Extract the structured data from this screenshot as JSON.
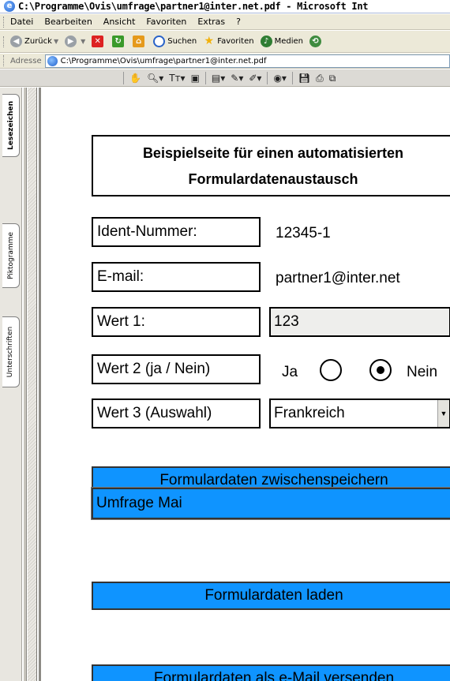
{
  "window": {
    "title": "C:\\Programme\\Ovis\\umfrage\\partner1@inter.net.pdf - Microsoft Int"
  },
  "menu": [
    "Datei",
    "Bearbeiten",
    "Ansicht",
    "Favoriten",
    "Extras",
    "?"
  ],
  "toolbar": {
    "back": "Zurück",
    "search": "Suchen",
    "favorites": "Favoriten",
    "media": "Medien"
  },
  "address": {
    "label": "Adresse",
    "url": "C:\\Programme\\Ovis\\umfrage\\partner1@inter.net.pdf"
  },
  "side_tabs": [
    "Lesezeichen",
    "Piktogramme",
    "Unterschriften"
  ],
  "form": {
    "title_line1": "Beispielseite für einen automatisierten",
    "title_line2": "Formulardatenaustausch",
    "ident_label": "Ident-Nummer:",
    "ident_value": "12345-1",
    "email_label": "E-mail:",
    "email_value": "partner1@inter.net",
    "wert1_label": "Wert 1:",
    "wert1_value": "123",
    "wert2_label": "Wert 2 (ja / Nein)",
    "wert2_yes": "Ja",
    "wert2_no": "Nein",
    "wert2_selected": "Nein",
    "wert3_label": "Wert 3 (Auswahl)",
    "wert3_value": "Frankreich",
    "btn_save": "Formulardaten zwischenspeichern",
    "save_name": "Umfrage Mai",
    "btn_load": "Formulardaten laden",
    "btn_send": "Formulardaten als e-Mail versenden"
  },
  "colors": {
    "button_blue": "#0f94ff",
    "field_grey": "#eeeeec"
  }
}
